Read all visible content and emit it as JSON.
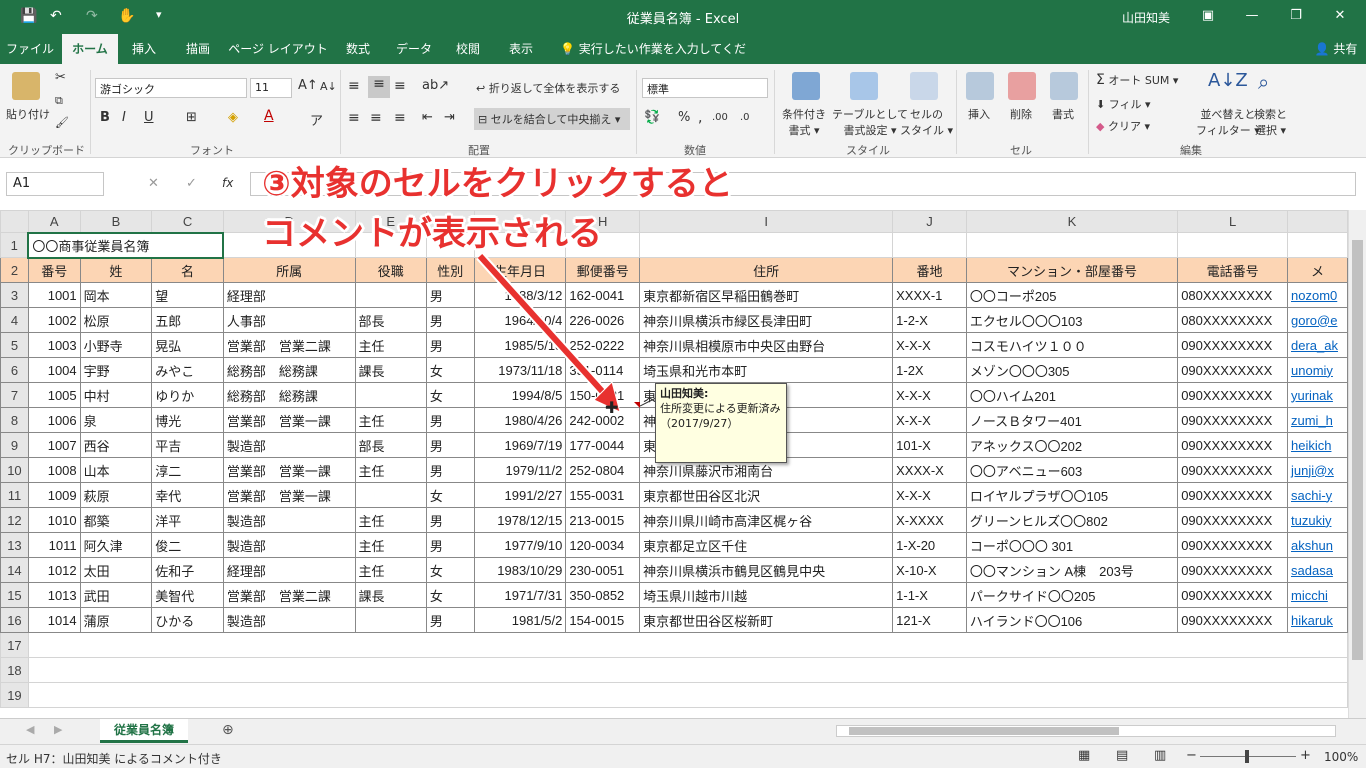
{
  "window": {
    "title": "従業員名簿 - Excel",
    "user": "山田知美"
  },
  "ribbon_tabs": [
    "ファイル",
    "ホーム",
    "挿入",
    "描画",
    "ページ レイアウト",
    "数式",
    "データ",
    "校閲",
    "表示"
  ],
  "tell_me": "実行したい作業を入力してください",
  "share": "共有",
  "ribbon": {
    "clipboard": {
      "paste": "貼り付け",
      "group": "クリップボード"
    },
    "font": {
      "name": "游ゴシック",
      "size": "11",
      "group": "フォント"
    },
    "alignment": {
      "wrap": "折り返して全体を表示する",
      "merge": "セルを結合して中央揃え",
      "group": "配置"
    },
    "number": {
      "format": "標準",
      "group": "数値"
    },
    "styles": {
      "conditional": "条件付き",
      "conditional2": "書式",
      "table": "テーブルとして",
      "table2": "書式設定",
      "cell": "セルの",
      "cell2": "スタイル",
      "group": "スタイル"
    },
    "cells": {
      "insert": "挿入",
      "delete": "削除",
      "format": "書式",
      "group": "セル"
    },
    "editing": {
      "autosum": "オート SUM",
      "fill": "フィル",
      "clear": "クリア",
      "sort": "並べ替えと",
      "sort2": "フィルター",
      "find": "検索と",
      "find2": "選択",
      "group": "編集"
    }
  },
  "formula_bar": {
    "name_box": "A1",
    "fx": "fx"
  },
  "columns": [
    "A",
    "B",
    "C",
    "D",
    "E",
    "F",
    "G",
    "H",
    "I",
    "J",
    "K",
    "L"
  ],
  "title_cell": "〇〇商事従業員名簿",
  "headers": [
    "番号",
    "姓",
    "名",
    "所属",
    "役職",
    "性別",
    "生年月日",
    "郵便番号",
    "住所",
    "番地",
    "マンション・部屋番号",
    "電話番号",
    "メ"
  ],
  "rows": [
    [
      "1001",
      "岡本",
      "望",
      "経理部",
      "",
      "男",
      "1988/3/12",
      "162-0041",
      "東京都新宿区早稲田鶴巻町",
      "XXXX-1",
      "〇〇コーポ205",
      "080XXXXXXXX",
      "nozom0"
    ],
    [
      "1002",
      "松原",
      "五郎",
      "人事部",
      "部長",
      "男",
      "1964/10/4",
      "226-0026",
      "神奈川県横浜市緑区長津田町",
      "1-2-X",
      "エクセル〇〇〇103",
      "080XXXXXXXX",
      "goro@e"
    ],
    [
      "1003",
      "小野寺",
      "晃弘",
      "営業部　営業二課",
      "主任",
      "男",
      "1985/5/18",
      "252-0222",
      "神奈川県相模原市中央区由野台",
      "X-X-X",
      "コスモハイツ１００",
      "090XXXXXXXX",
      "dera_ak"
    ],
    [
      "1004",
      "宇野",
      "みやこ",
      "総務部　総務課",
      "課長",
      "女",
      "1973/11/18",
      "351-0114",
      "埼玉県和光市本町",
      "1-2X",
      "メゾン〇〇〇305",
      "090XXXXXXXX",
      "unomiy"
    ],
    [
      "1005",
      "中村",
      "ゆりか",
      "総務部　総務課",
      "",
      "女",
      "1994/8/5",
      "150-0031",
      "東京都渋谷区桜丘町",
      "X-X-X",
      "〇〇ハイム201",
      "090XXXXXXXX",
      "yurinak"
    ],
    [
      "1006",
      "泉",
      "博光",
      "営業部　営業一課",
      "主任",
      "男",
      "1980/4/26",
      "242-0002",
      "神奈川県大和市つきみ野",
      "X-X-X",
      "ノースＢタワー401",
      "090XXXXXXXX",
      "zumi_h"
    ],
    [
      "1007",
      "西谷",
      "平吉",
      "製造部",
      "部長",
      "男",
      "1969/7/19",
      "177-0044",
      "東京都練馬区上石神井",
      "101-X",
      "アネックス〇〇202",
      "090XXXXXXXX",
      "heikich"
    ],
    [
      "1008",
      "山本",
      "淳二",
      "営業部　営業一課",
      "主任",
      "男",
      "1979/11/2",
      "252-0804",
      "神奈川県藤沢市湘南台",
      "XXXX-X",
      "〇〇アベニュー603",
      "090XXXXXXXX",
      "junji@x"
    ],
    [
      "1009",
      "萩原",
      "幸代",
      "営業部　営業一課",
      "",
      "女",
      "1991/2/27",
      "155-0031",
      "東京都世田谷区北沢",
      "X-X-X",
      "ロイヤルプラザ〇〇105",
      "090XXXXXXXX",
      "sachi-y"
    ],
    [
      "1010",
      "都築",
      "洋平",
      "製造部",
      "主任",
      "男",
      "1978/12/15",
      "213-0015",
      "神奈川県川崎市高津区梶ヶ谷",
      "X-XXXX",
      "グリーンヒルズ〇〇802",
      "090XXXXXXXX",
      "tuzukiy"
    ],
    [
      "1011",
      "阿久津",
      "俊二",
      "製造部",
      "主任",
      "男",
      "1977/9/10",
      "120-0034",
      "東京都足立区千住",
      "1-X-20",
      "コーポ〇〇〇 301",
      "090XXXXXXXX",
      "akshun"
    ],
    [
      "1012",
      "太田",
      "佐和子",
      "経理部",
      "主任",
      "女",
      "1983/10/29",
      "230-0051",
      "神奈川県横浜市鶴見区鶴見中央",
      "X-10-X",
      "〇〇マンション A棟　203号",
      "090XXXXXXXX",
      "sadasa"
    ],
    [
      "1013",
      "武田",
      "美智代",
      "営業部　営業二課",
      "課長",
      "女",
      "1971/7/31",
      "350-0852",
      "埼玉県川越市川越",
      "1-1-X",
      "パークサイド〇〇205",
      "090XXXXXXXX",
      "micchi"
    ],
    [
      "1014",
      "蒲原",
      "ひかる",
      "製造部",
      "",
      "男",
      "1981/5/2",
      "154-0015",
      "東京都世田谷区桜新町",
      "121-X",
      "ハイランド〇〇106",
      "090XXXXXXXX",
      "hikaruk"
    ]
  ],
  "comment": {
    "author": "山田知美:",
    "text": "住所変更による更新済み（2017/9/27）"
  },
  "annotation": {
    "line1": "③対象のセルをクリックすると",
    "line2": "コメントが表示される"
  },
  "sheet_tab": "従業員名簿",
  "status": {
    "text": "セル H7：山田知美 によるコメント付き",
    "zoom": "100%"
  },
  "colors": {
    "excel_green": "#217346",
    "header_fill": "#fcd5b4",
    "annotation_red": "#e8312f",
    "comment_bg": "#ffffe1"
  }
}
